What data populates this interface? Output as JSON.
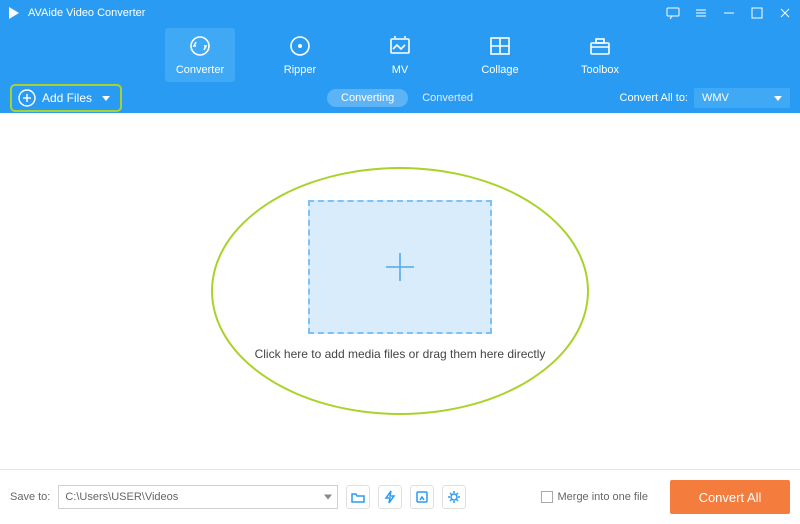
{
  "app": {
    "title": "AVAide Video Converter"
  },
  "tabs": {
    "converter": "Converter",
    "ripper": "Ripper",
    "mv": "MV",
    "collage": "Collage",
    "toolbox": "Toolbox"
  },
  "toolbar": {
    "add_files": "Add Files",
    "converting": "Converting",
    "converted": "Converted",
    "convert_all_to": "Convert All to:",
    "format": "WMV"
  },
  "dropzone": {
    "hint": "Click here to add media files or drag them here directly"
  },
  "footer": {
    "save_to_label": "Save to:",
    "save_path": "C:\\Users\\USER\\Videos",
    "merge_label": "Merge into one file",
    "convert_all": "Convert All"
  }
}
